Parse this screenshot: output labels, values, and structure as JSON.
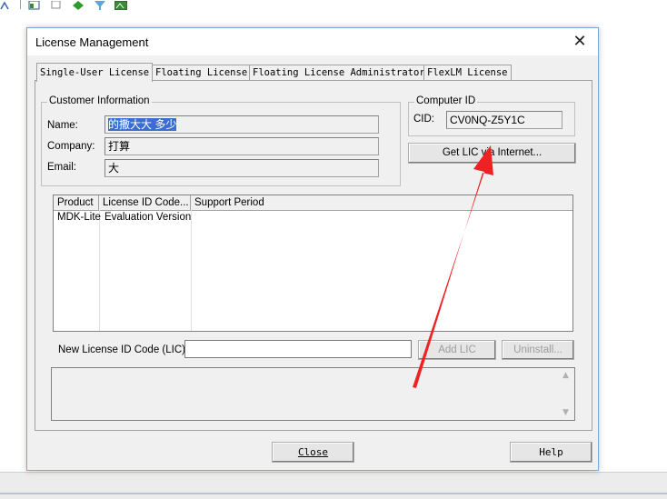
{
  "dialog": {
    "title": "License Management",
    "close_icon": "close-icon"
  },
  "tabs": [
    {
      "label": "Single-User License",
      "active": true
    },
    {
      "label": "Floating License",
      "active": false
    },
    {
      "label": "Floating License Administrator",
      "active": false
    },
    {
      "label": "FlexLM License",
      "active": false
    }
  ],
  "customer": {
    "group_label": "Customer Information",
    "name_label": "Name:",
    "name_value": "的撒大大 多少",
    "company_label": "Company:",
    "company_value": "打算",
    "email_label": "Email:",
    "email_value": "大"
  },
  "computer": {
    "group_label": "Computer ID",
    "cid_label": "CID:",
    "cid_value": "CV0NQ-Z5Y1C",
    "get_lic_button": "Get LIC via Internet..."
  },
  "license_table": {
    "columns": [
      "Product",
      "License ID Code...",
      "Support Period"
    ],
    "rows": [
      [
        "MDK-Lite",
        "Evaluation Version",
        ""
      ]
    ]
  },
  "new_lic": {
    "label": "New License ID Code (LIC):",
    "value": "",
    "add_button": "Add LIC",
    "uninstall_button": "Uninstall..."
  },
  "footer": {
    "close_button": "Close",
    "help_button": "Help"
  },
  "annotation": {
    "color": "#ee2222"
  }
}
